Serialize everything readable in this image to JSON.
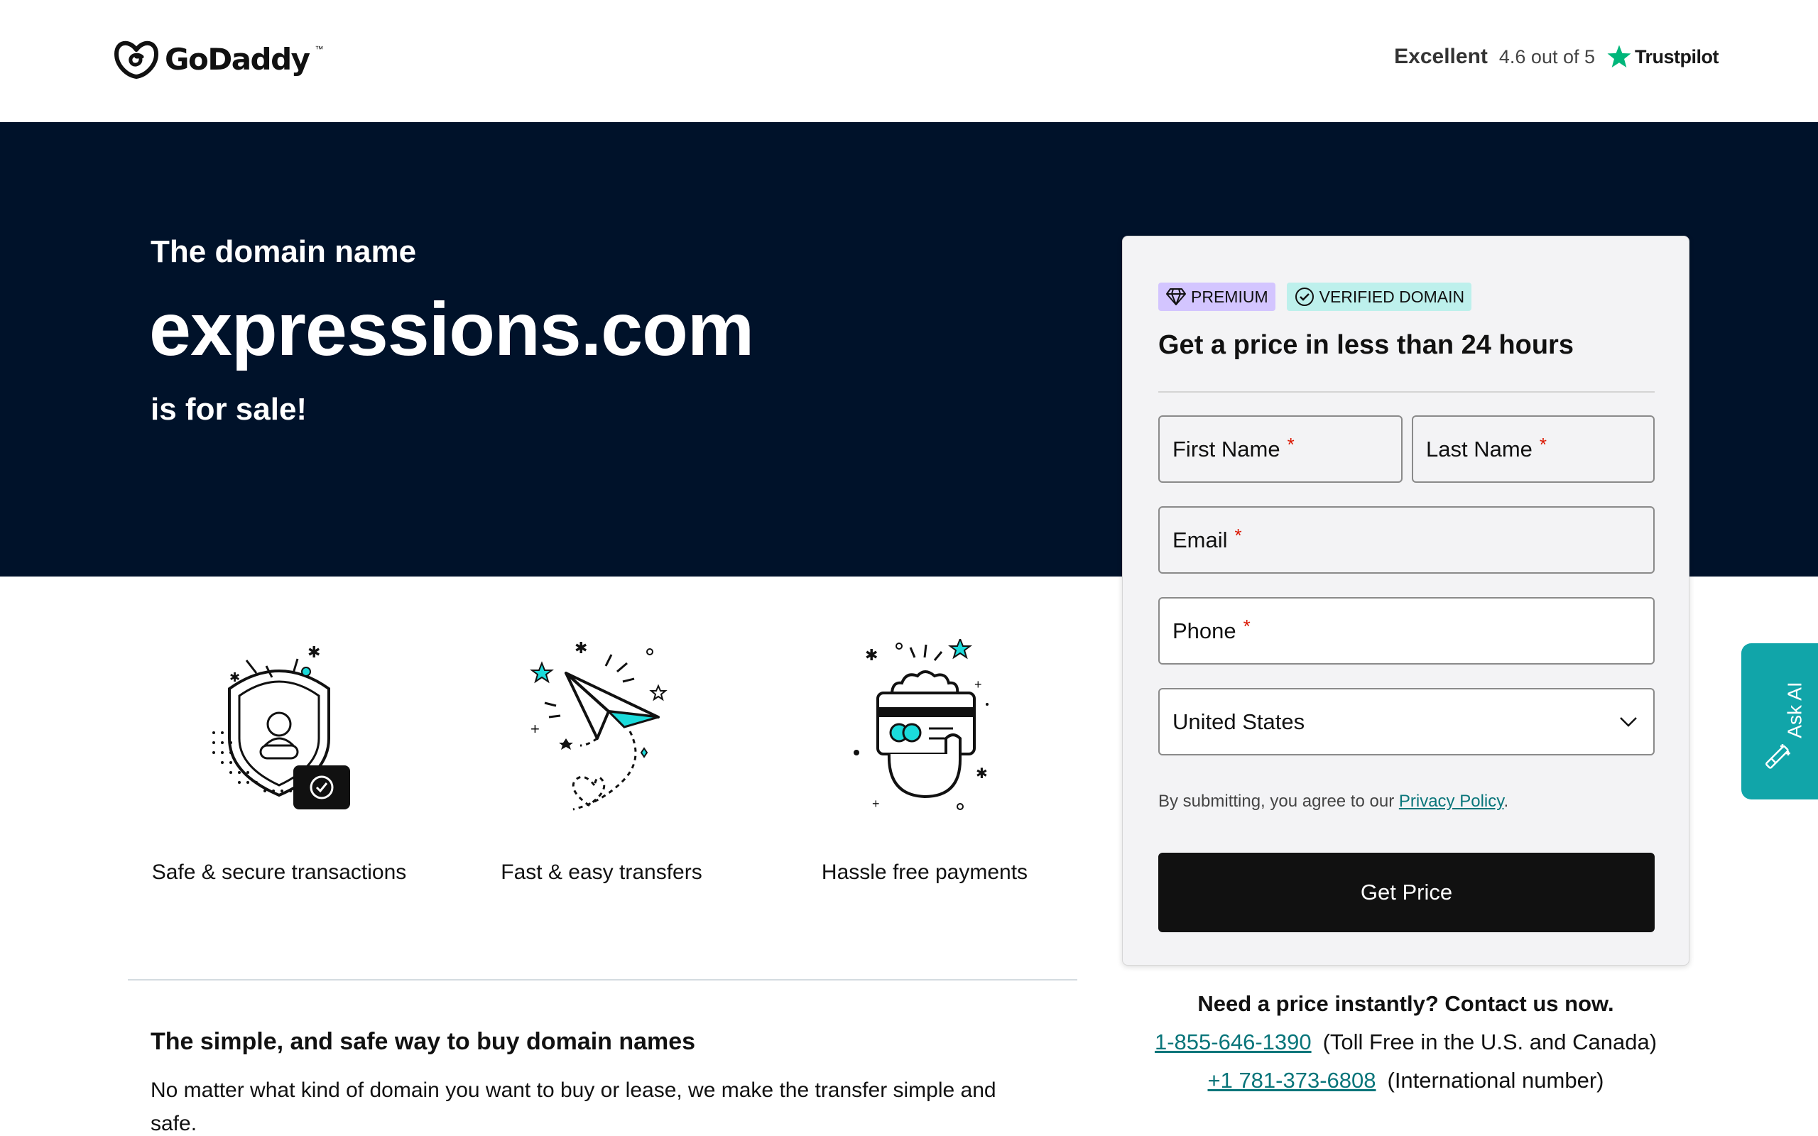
{
  "header": {
    "logo_text": "GoDaddy",
    "rating_label": "Excellent",
    "rating_score": "4.6 out of 5",
    "trustpilot": "Trustpilot"
  },
  "hero": {
    "pre": "The domain name",
    "domain": "expressions.com",
    "post": "is for sale!",
    "background": "#00122a"
  },
  "features": [
    {
      "label": "Safe & secure transactions",
      "icon": "shield-icon"
    },
    {
      "label": "Fast & easy transfers",
      "icon": "paper-plane-icon"
    },
    {
      "label": "Hassle free payments",
      "icon": "card-hand-icon"
    }
  ],
  "about": {
    "title": "The simple, and safe way to buy domain names",
    "text": "No matter what kind of domain you want to buy or lease, we make the transfer simple and safe."
  },
  "form": {
    "badge_premium": "PREMIUM",
    "badge_verified": "VERIFIED DOMAIN",
    "title": "Get a price in less than 24 hours",
    "first_name": "First Name",
    "last_name": "Last Name",
    "email": "Email",
    "phone": "Phone",
    "required_mark": "*",
    "country": "United States",
    "agree_prefix": "By submitting, you agree to our",
    "privacy_link": "Privacy Policy",
    "agree_suffix": ".",
    "submit": "Get Price"
  },
  "contact": {
    "title": "Need a price instantly? Contact us now.",
    "phone_1": "1-855-646-1390",
    "phone_1_note": "(Toll Free in the U.S. and Canada)",
    "phone_2": "+1 781-373-6808",
    "phone_2_note": "(International number)"
  },
  "ask_ai": {
    "label": "Ask AI"
  },
  "colors": {
    "accent": "#09757a",
    "teal": "#11a5a9",
    "required": "#db1802",
    "premium_badge": "#d3c5ff",
    "verified_badge": "#bdf0ec"
  }
}
